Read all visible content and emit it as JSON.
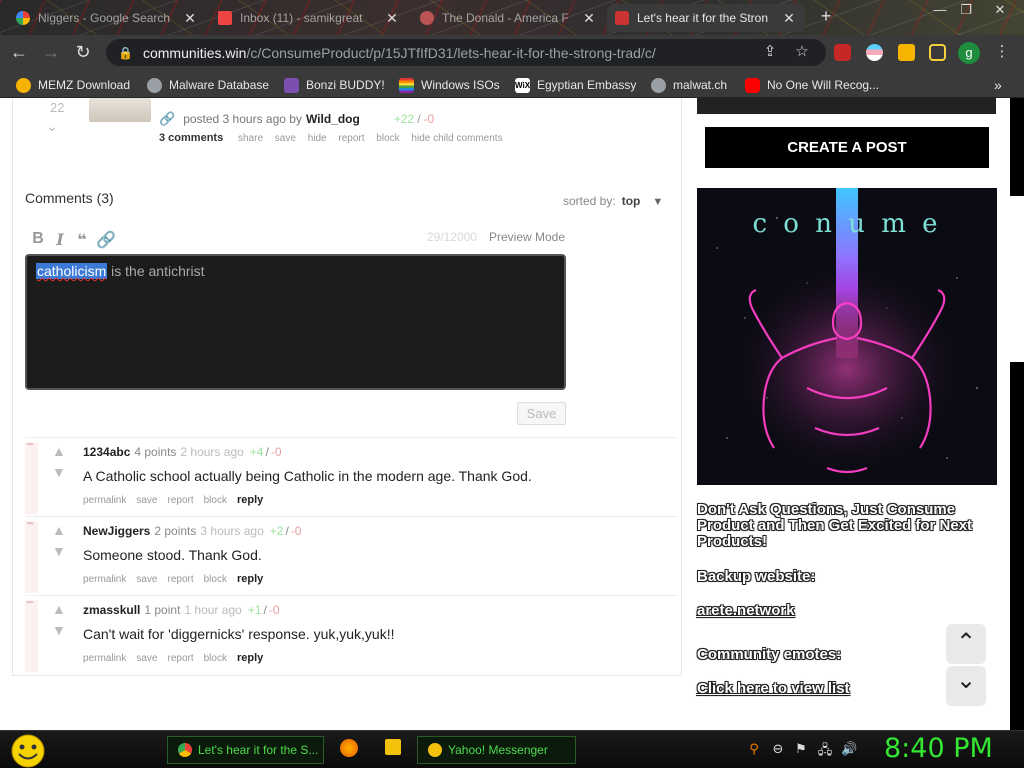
{
  "browser": {
    "tabs": [
      {
        "title": "Niggers - Google Search",
        "active": false
      },
      {
        "title": "Inbox (11) - samikgreat",
        "active": false
      },
      {
        "title": "The Donald - America F",
        "active": false
      },
      {
        "title": "Let's hear it for the Stron",
        "active": true
      }
    ],
    "url_host": "communities.win",
    "url_path": "/c/ConsumeProduct/p/15JTfIfD31/lets-hear-it-for-the-strong-trad/c/",
    "profile_initial": "g",
    "bookmarks": [
      {
        "label": "MEMZ Download",
        "icon_color": "#f4b400"
      },
      {
        "label": "Malware Database",
        "icon_color": "#9aa0a6"
      },
      {
        "label": "Bonzi BUDDY!",
        "icon_color": "#7b4fb0"
      },
      {
        "label": "Windows ISOs",
        "icon_color": "#e53935"
      },
      {
        "label": "Egyptian Embassy",
        "icon_color": "#ffffff"
      },
      {
        "label": "malwat.ch",
        "icon_color": "#9aa0a6"
      },
      {
        "label": "No One Will Recog...",
        "icon_color": "#ff0000"
      }
    ]
  },
  "post": {
    "score": "22",
    "meta_prefix": "posted 3 hours ago by",
    "author": "Wild_dog",
    "votes_up": "+22",
    "votes_sep": "/",
    "votes_down": "-0",
    "actions": [
      "3 comments",
      "share",
      "save",
      "hide",
      "report",
      "block",
      "hide child comments"
    ]
  },
  "comments_section": {
    "header": "Comments (3)",
    "sorted_label": "sorted by:",
    "sorted_value": "top",
    "char_count": "29/12000",
    "preview_label": "Preview Mode",
    "editor_selected": "catholicism",
    "editor_rest": " is the antichrist",
    "save_label": "Save"
  },
  "comments": [
    {
      "user": "1234abc",
      "points": "4 points",
      "ago": "2 hours ago",
      "up": "+4",
      "sep": "/",
      "down": "-0",
      "body": "A Catholic school actually being Catholic in the modern age. Thank God."
    },
    {
      "user": "NewJiggers",
      "points": "2 points",
      "ago": "3 hours ago",
      "up": "+2",
      "sep": "/",
      "down": "-0",
      "body": "Someone stood. Thank God."
    },
    {
      "user": "zmasskull",
      "points": "1 point",
      "ago": "1 hour ago",
      "up": "+1",
      "sep": "/",
      "down": "-0",
      "body": "Can't wait for 'diggernicks' response. yuk,yuk,yuk!!"
    }
  ],
  "comment_actions": [
    "permalink",
    "save",
    "report",
    "block",
    "reply"
  ],
  "sidebar": {
    "create_post": "CREATE A POST",
    "banner_text": "c o n   u m e",
    "tagline": "Don't Ask Questions, Just Consume Product and Then Get Excited for Next Products!",
    "backup_label": "Backup website:",
    "backup_link": "arete.network",
    "emotes_label": "Community emotes:",
    "emotes_link": "Click here to view list"
  },
  "taskbar": {
    "tasks": [
      {
        "label": "Let's hear it for the S...",
        "icon_color": "#4285f4"
      },
      {
        "label": "Yahoo! Messenger",
        "icon_color": "#f4c20d"
      }
    ],
    "clock": "8:40 PM"
  }
}
